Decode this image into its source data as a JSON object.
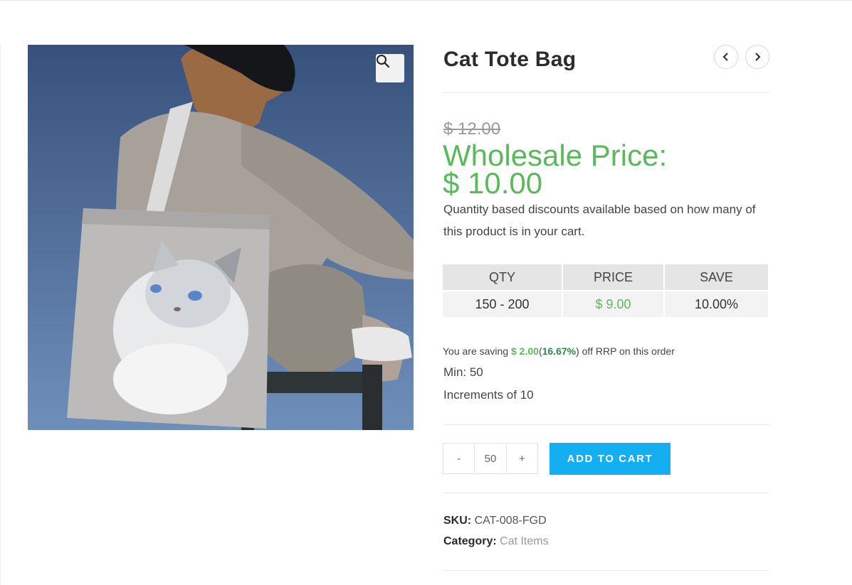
{
  "product": {
    "title": "Cat Tote Bag",
    "old_price": "$ 12.00",
    "wholesale_label": "Wholesale Price:",
    "wholesale_price": "$ 10.00",
    "description": "Quantity based discounts available based on how many of this product is in your cart."
  },
  "pricing_table": {
    "headers": [
      "QTY",
      "PRICE",
      "SAVE"
    ],
    "rows": [
      {
        "qty": "150 - 200",
        "price": "$ 9.00",
        "save": "10.00%"
      }
    ]
  },
  "saving": {
    "prefix": "You are saving",
    "amount": "$ 2.00",
    "open_paren": "(",
    "percent": "16.67%",
    "suffix": ") off RRP on this order"
  },
  "min_label": "Min: 50",
  "increments_label": "Increments of 10",
  "cart": {
    "minus": "-",
    "quantity": "50",
    "plus": "+",
    "button": "ADD TO CART"
  },
  "meta": {
    "sku_label": "SKU:",
    "sku_value": "CAT-008-FGD",
    "category_label": "Category:",
    "category_value": "Cat Items"
  },
  "icons": {
    "zoom": "search-icon",
    "prev": "chevron-left-icon",
    "next": "chevron-right-icon"
  },
  "colors": {
    "accent_green": "#5cb85c",
    "button_blue": "#13aff0"
  }
}
